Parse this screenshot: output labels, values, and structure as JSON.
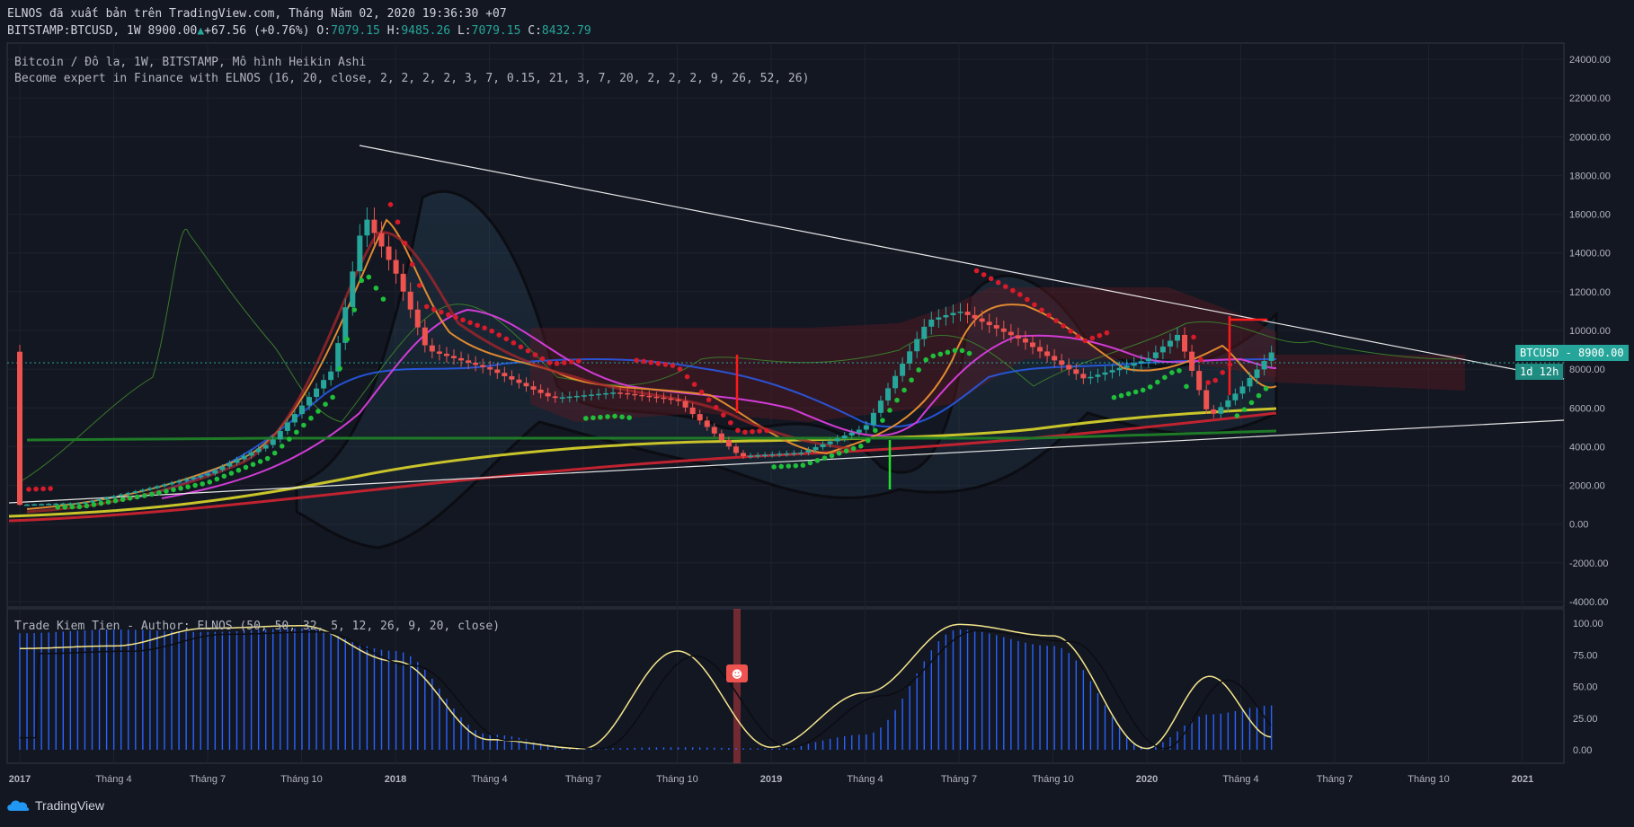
{
  "header": {
    "published": "ELNOS đã xuất bản trên TradingView.com, Tháng Năm 02, 2020 19:36:30 +07",
    "symbol": "BITSTAMP:BTCUSD, 1W",
    "last": "8900.00",
    "change": "+67.56 (+0.76%)",
    "o_label": "O:",
    "o": "7079.15",
    "h_label": "H:",
    "h": "9485.26",
    "l_label": "L:",
    "l": "7079.15",
    "c_label": "C:",
    "c": "8432.79"
  },
  "legend": {
    "line1": "Bitcoin / Đô la, 1W, BITSTAMP, Mô hình Heikin Ashi",
    "line2": "Become expert in Finance with ELNOS (16, 20, close, 2, 2, 2, 2, 3, 7, 0.15, 21, 3, 7, 20, 2, 2, 2, 9, 26, 52, 26)",
    "line3": "Trade Kiem Tien - Author: ELNOS (50, 50, 32, 5, 12, 26, 9, 20, close)"
  },
  "price_label": "BTCUSD",
  "price_value": "8900.00",
  "countdown": "1d 12h",
  "brand": "TradingView",
  "colors": {
    "background": "#131722",
    "up": "#26a69a",
    "down": "#ef5350",
    "price_tag": "#26a69a",
    "oscillator": "#f5e68c",
    "histogram": "#2962ff"
  },
  "chart_data": [
    {
      "type": "line",
      "title": "Bitcoin / Đô la, 1W, BITSTAMP, Mô hình Heikin Ashi",
      "y_ticks": [
        "24000.00",
        "22000.00",
        "20000.00",
        "18000.00",
        "16000.00",
        "14000.00",
        "12000.00",
        "10000.00",
        "8000.00",
        "6000.00",
        "4000.00",
        "2000.00",
        "0.00",
        "-2000.00",
        "-4000.00"
      ],
      "x_ticks": [
        "2017",
        "Tháng 4",
        "Tháng 7",
        "Tháng 10",
        "2018",
        "Tháng 4",
        "Tháng 7",
        "Tháng 10",
        "2019",
        "Tháng 4",
        "Tháng 7",
        "Tháng 10",
        "2020",
        "Tháng 4",
        "Tháng 7",
        "Tháng 10",
        "2021"
      ],
      "ylim": [
        -4000,
        24000
      ],
      "series": [
        {
          "x": [
            "2017-01",
            "2017-03",
            "2017-05",
            "2017-07",
            "2017-09",
            "2017-11",
            "2017-12",
            "2018-01",
            "2018-02",
            "2018-04",
            "2018-06",
            "2018-08",
            "2018-10",
            "2018-12",
            "2019-02",
            "2019-04",
            "2019-06",
            "2019-07",
            "2019-09",
            "2019-11",
            "2020-01",
            "2020-02",
            "2020-03",
            "2020-04",
            "2020-05"
          ],
          "values": [
            1000,
            1100,
            1800,
            2600,
            4200,
            8000,
            16000,
            13000,
            9000,
            8000,
            6500,
            6800,
            6400,
            3500,
            3700,
            5000,
            10500,
            11000,
            9500,
            7500,
            8500,
            9800,
            5500,
            7000,
            8900
          ]
        }
      ],
      "grid": true
    },
    {
      "type": "bar",
      "title": "Trade Kiem Tien - Author: ELNOS (50, 50, 32, 5, 12, 26, 9, 20, close)",
      "y_ticks": [
        "100.00",
        "75.00",
        "50.00",
        "25.00",
        "0.00"
      ],
      "ylim": [
        0,
        100
      ],
      "x": [
        "2017-01",
        "2017-04",
        "2017-07",
        "2017-10",
        "2018-01",
        "2018-04",
        "2018-07",
        "2018-10",
        "2019-01",
        "2019-04",
        "2019-07",
        "2019-10",
        "2020-01",
        "2020-03",
        "2020-05"
      ],
      "histogram": [
        92,
        95,
        93,
        96,
        78,
        12,
        1,
        2,
        1,
        12,
        95,
        82,
        2,
        28,
        35
      ],
      "oscillator": [
        80,
        82,
        96,
        98,
        70,
        8,
        1,
        78,
        2,
        45,
        99,
        90,
        1,
        58,
        10
      ]
    }
  ]
}
